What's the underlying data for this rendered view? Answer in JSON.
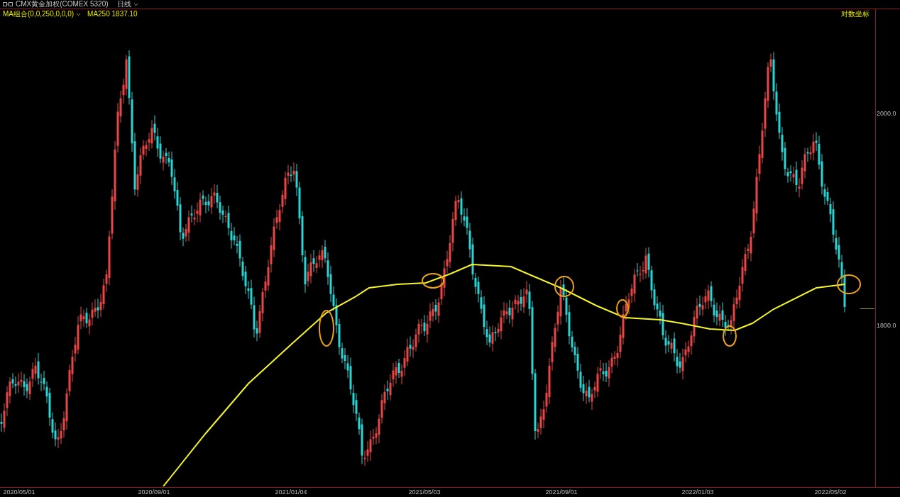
{
  "header": {
    "symbol": "CMX黄金加权(COMEX 5320)",
    "period": "日线"
  },
  "indicator": {
    "name": "MA组合(0,0,250,0,0,0)",
    "reading": "MA250 1837.10"
  },
  "scale_mode": "对数坐标",
  "y_axis_labels": [
    "2000.0",
    "1800.0"
  ],
  "x_axis_labels": [
    "2020/05/01",
    "2020/09/01",
    "2021/01/04",
    "2021/05/03",
    "2021/09/01",
    "2022/01/03",
    "2022/05/02"
  ]
}
